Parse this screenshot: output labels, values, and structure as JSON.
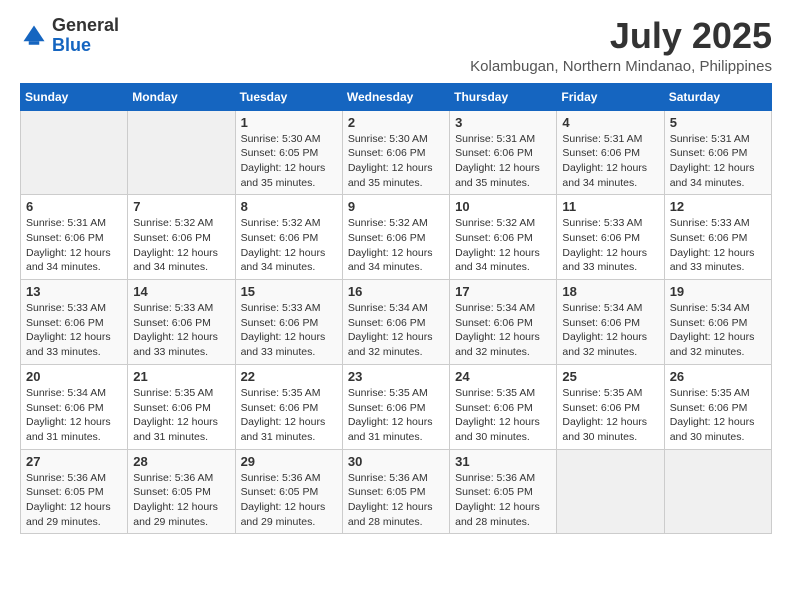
{
  "logo": {
    "general": "General",
    "blue": "Blue"
  },
  "title": "July 2025",
  "location": "Kolambugan, Northern Mindanao, Philippines",
  "weekdays": [
    "Sunday",
    "Monday",
    "Tuesday",
    "Wednesday",
    "Thursday",
    "Friday",
    "Saturday"
  ],
  "weeks": [
    [
      {
        "day": "",
        "sunrise": "",
        "sunset": "",
        "daylight": ""
      },
      {
        "day": "",
        "sunrise": "",
        "sunset": "",
        "daylight": ""
      },
      {
        "day": "1",
        "sunrise": "Sunrise: 5:30 AM",
        "sunset": "Sunset: 6:05 PM",
        "daylight": "Daylight: 12 hours and 35 minutes."
      },
      {
        "day": "2",
        "sunrise": "Sunrise: 5:30 AM",
        "sunset": "Sunset: 6:06 PM",
        "daylight": "Daylight: 12 hours and 35 minutes."
      },
      {
        "day": "3",
        "sunrise": "Sunrise: 5:31 AM",
        "sunset": "Sunset: 6:06 PM",
        "daylight": "Daylight: 12 hours and 35 minutes."
      },
      {
        "day": "4",
        "sunrise": "Sunrise: 5:31 AM",
        "sunset": "Sunset: 6:06 PM",
        "daylight": "Daylight: 12 hours and 34 minutes."
      },
      {
        "day": "5",
        "sunrise": "Sunrise: 5:31 AM",
        "sunset": "Sunset: 6:06 PM",
        "daylight": "Daylight: 12 hours and 34 minutes."
      }
    ],
    [
      {
        "day": "6",
        "sunrise": "Sunrise: 5:31 AM",
        "sunset": "Sunset: 6:06 PM",
        "daylight": "Daylight: 12 hours and 34 minutes."
      },
      {
        "day": "7",
        "sunrise": "Sunrise: 5:32 AM",
        "sunset": "Sunset: 6:06 PM",
        "daylight": "Daylight: 12 hours and 34 minutes."
      },
      {
        "day": "8",
        "sunrise": "Sunrise: 5:32 AM",
        "sunset": "Sunset: 6:06 PM",
        "daylight": "Daylight: 12 hours and 34 minutes."
      },
      {
        "day": "9",
        "sunrise": "Sunrise: 5:32 AM",
        "sunset": "Sunset: 6:06 PM",
        "daylight": "Daylight: 12 hours and 34 minutes."
      },
      {
        "day": "10",
        "sunrise": "Sunrise: 5:32 AM",
        "sunset": "Sunset: 6:06 PM",
        "daylight": "Daylight: 12 hours and 34 minutes."
      },
      {
        "day": "11",
        "sunrise": "Sunrise: 5:33 AM",
        "sunset": "Sunset: 6:06 PM",
        "daylight": "Daylight: 12 hours and 33 minutes."
      },
      {
        "day": "12",
        "sunrise": "Sunrise: 5:33 AM",
        "sunset": "Sunset: 6:06 PM",
        "daylight": "Daylight: 12 hours and 33 minutes."
      }
    ],
    [
      {
        "day": "13",
        "sunrise": "Sunrise: 5:33 AM",
        "sunset": "Sunset: 6:06 PM",
        "daylight": "Daylight: 12 hours and 33 minutes."
      },
      {
        "day": "14",
        "sunrise": "Sunrise: 5:33 AM",
        "sunset": "Sunset: 6:06 PM",
        "daylight": "Daylight: 12 hours and 33 minutes."
      },
      {
        "day": "15",
        "sunrise": "Sunrise: 5:33 AM",
        "sunset": "Sunset: 6:06 PM",
        "daylight": "Daylight: 12 hours and 33 minutes."
      },
      {
        "day": "16",
        "sunrise": "Sunrise: 5:34 AM",
        "sunset": "Sunset: 6:06 PM",
        "daylight": "Daylight: 12 hours and 32 minutes."
      },
      {
        "day": "17",
        "sunrise": "Sunrise: 5:34 AM",
        "sunset": "Sunset: 6:06 PM",
        "daylight": "Daylight: 12 hours and 32 minutes."
      },
      {
        "day": "18",
        "sunrise": "Sunrise: 5:34 AM",
        "sunset": "Sunset: 6:06 PM",
        "daylight": "Daylight: 12 hours and 32 minutes."
      },
      {
        "day": "19",
        "sunrise": "Sunrise: 5:34 AM",
        "sunset": "Sunset: 6:06 PM",
        "daylight": "Daylight: 12 hours and 32 minutes."
      }
    ],
    [
      {
        "day": "20",
        "sunrise": "Sunrise: 5:34 AM",
        "sunset": "Sunset: 6:06 PM",
        "daylight": "Daylight: 12 hours and 31 minutes."
      },
      {
        "day": "21",
        "sunrise": "Sunrise: 5:35 AM",
        "sunset": "Sunset: 6:06 PM",
        "daylight": "Daylight: 12 hours and 31 minutes."
      },
      {
        "day": "22",
        "sunrise": "Sunrise: 5:35 AM",
        "sunset": "Sunset: 6:06 PM",
        "daylight": "Daylight: 12 hours and 31 minutes."
      },
      {
        "day": "23",
        "sunrise": "Sunrise: 5:35 AM",
        "sunset": "Sunset: 6:06 PM",
        "daylight": "Daylight: 12 hours and 31 minutes."
      },
      {
        "day": "24",
        "sunrise": "Sunrise: 5:35 AM",
        "sunset": "Sunset: 6:06 PM",
        "daylight": "Daylight: 12 hours and 30 minutes."
      },
      {
        "day": "25",
        "sunrise": "Sunrise: 5:35 AM",
        "sunset": "Sunset: 6:06 PM",
        "daylight": "Daylight: 12 hours and 30 minutes."
      },
      {
        "day": "26",
        "sunrise": "Sunrise: 5:35 AM",
        "sunset": "Sunset: 6:06 PM",
        "daylight": "Daylight: 12 hours and 30 minutes."
      }
    ],
    [
      {
        "day": "27",
        "sunrise": "Sunrise: 5:36 AM",
        "sunset": "Sunset: 6:05 PM",
        "daylight": "Daylight: 12 hours and 29 minutes."
      },
      {
        "day": "28",
        "sunrise": "Sunrise: 5:36 AM",
        "sunset": "Sunset: 6:05 PM",
        "daylight": "Daylight: 12 hours and 29 minutes."
      },
      {
        "day": "29",
        "sunrise": "Sunrise: 5:36 AM",
        "sunset": "Sunset: 6:05 PM",
        "daylight": "Daylight: 12 hours and 29 minutes."
      },
      {
        "day": "30",
        "sunrise": "Sunrise: 5:36 AM",
        "sunset": "Sunset: 6:05 PM",
        "daylight": "Daylight: 12 hours and 28 minutes."
      },
      {
        "day": "31",
        "sunrise": "Sunrise: 5:36 AM",
        "sunset": "Sunset: 6:05 PM",
        "daylight": "Daylight: 12 hours and 28 minutes."
      },
      {
        "day": "",
        "sunrise": "",
        "sunset": "",
        "daylight": ""
      },
      {
        "day": "",
        "sunrise": "",
        "sunset": "",
        "daylight": ""
      }
    ]
  ]
}
